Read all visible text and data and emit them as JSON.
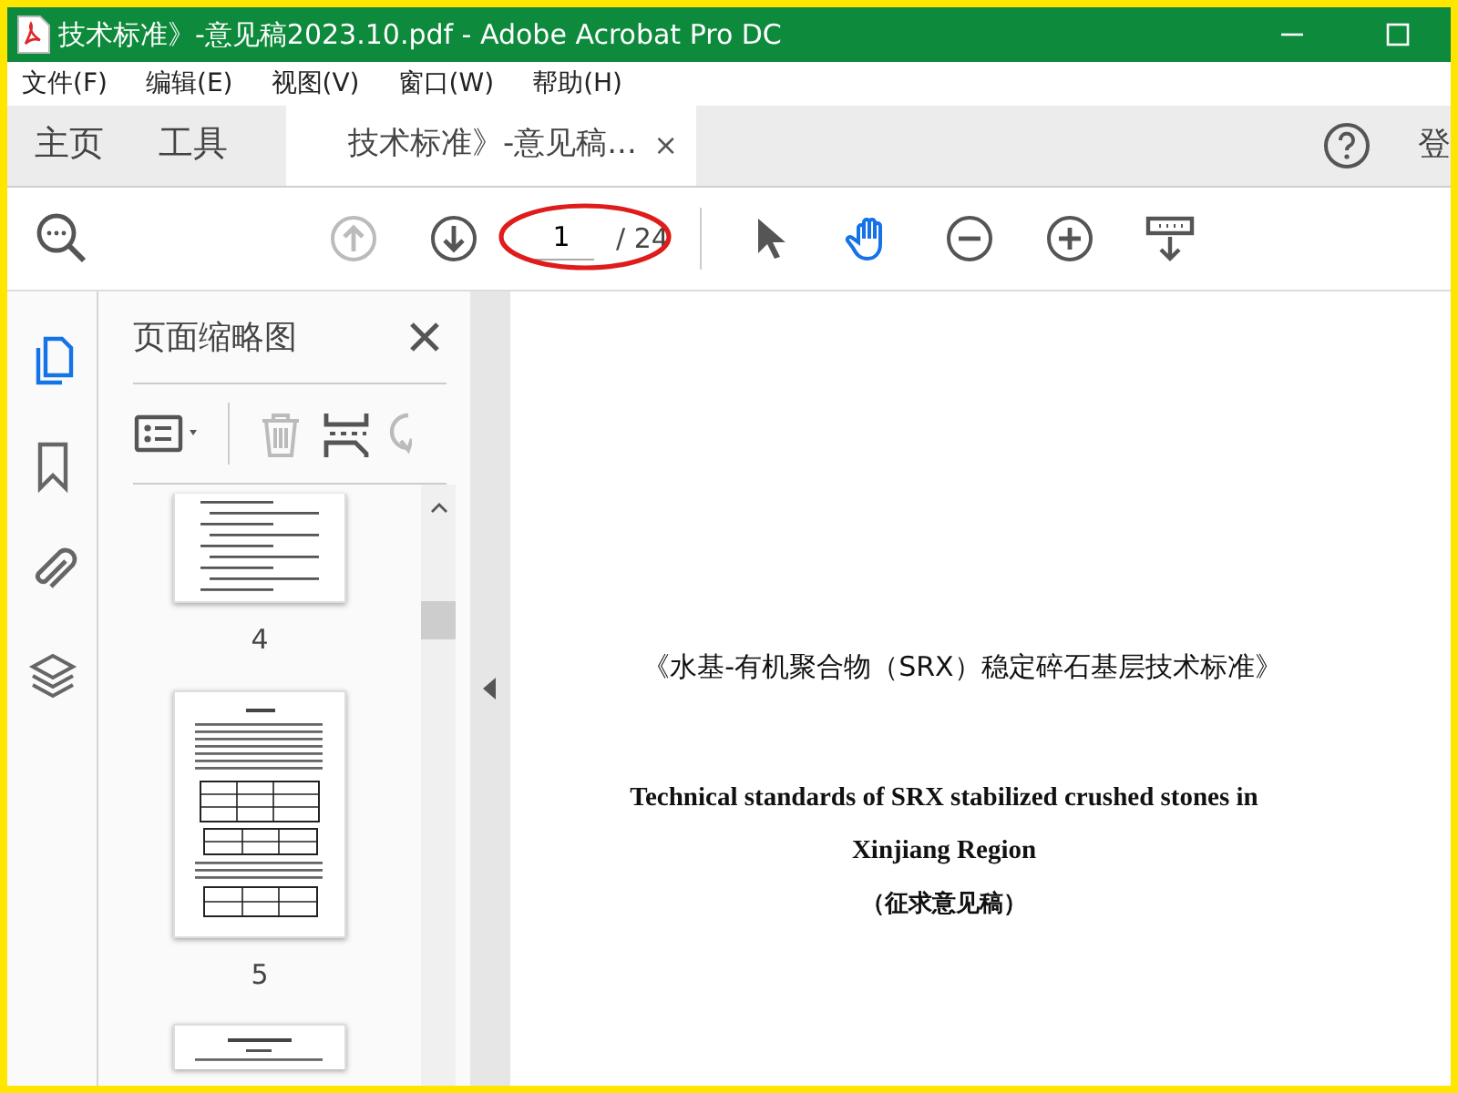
{
  "window": {
    "title": "技术标准》-意见稿2023.10.pdf - Adobe Acrobat Pro DC"
  },
  "menu": [
    {
      "label": "文件(F)"
    },
    {
      "label": "编辑(E)"
    },
    {
      "label": "视图(V)"
    },
    {
      "label": "窗口(W)"
    },
    {
      "label": "帮助(H)"
    }
  ],
  "tabs": [
    {
      "label": "主页",
      "kind": "nav",
      "selected": false
    },
    {
      "label": "工具",
      "kind": "nav",
      "selected": false
    },
    {
      "label": "技术标准》-意见稿...",
      "kind": "document",
      "selected": true,
      "close": "×"
    }
  ],
  "account_label": "登",
  "toolbar": {
    "nav": [
      {
        "kind": "prev",
        "disabled": true
      },
      {
        "kind": "next",
        "disabled": false
      }
    ],
    "page_current": "1",
    "page_total": "/ 24",
    "tools": [
      {
        "kind": "select",
        "selected": false
      },
      {
        "kind": "hand",
        "selected": true
      },
      {
        "kind": "zoom-out",
        "selected": false
      },
      {
        "kind": "zoom-in",
        "selected": false
      },
      {
        "kind": "fit",
        "selected": false
      }
    ]
  },
  "sidebar": {
    "items": [
      {
        "kind": "pages",
        "selected": true
      },
      {
        "kind": "bookmarks",
        "selected": false
      },
      {
        "kind": "attachments",
        "selected": false
      },
      {
        "kind": "layers",
        "selected": false
      }
    ]
  },
  "panel": {
    "title": "页面缩略图",
    "tools": [
      {
        "kind": "options",
        "disabled": false
      },
      {
        "kind": "delete",
        "disabled": true
      },
      {
        "kind": "insert",
        "disabled": false
      },
      {
        "kind": "rotate",
        "disabled": true
      }
    ],
    "thumbnails": [
      {
        "label": "4",
        "kind": "text-cut"
      },
      {
        "label": "5",
        "kind": "tables"
      },
      {
        "kind": "heading-cut"
      }
    ]
  },
  "document": {
    "lines": [
      {
        "text": "《水基-有机聚合物（SRX）稳定碎石基层技术标准》",
        "kind": "title-cn"
      },
      {
        "text": "Technical standards of SRX stabilized crushed stones in",
        "kind": "title-en"
      },
      {
        "text": "Xinjiang Region",
        "kind": "title-en"
      },
      {
        "text": "（征求意见稿）",
        "kind": "subtitle"
      }
    ]
  }
}
